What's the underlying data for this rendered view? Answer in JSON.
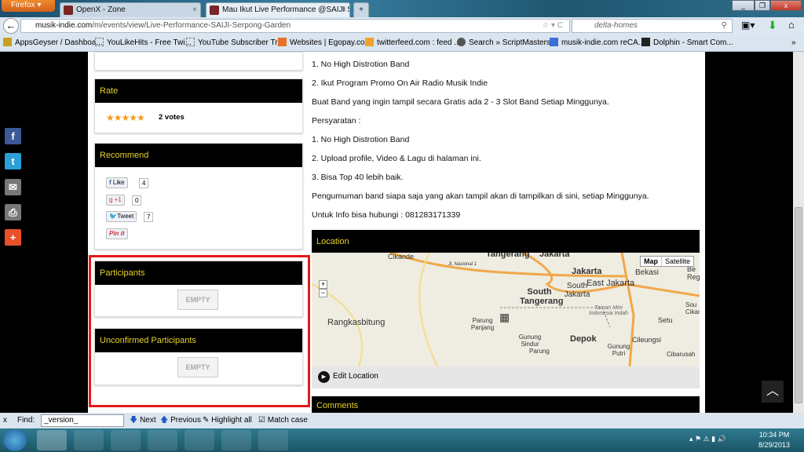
{
  "browser": {
    "menu_label": "Firefox",
    "tabs": [
      {
        "title": "OpenX - Zone"
      },
      {
        "title": "Mau Ikut Live Performance @SAIJI Se..."
      }
    ],
    "new_tab": "+",
    "url_domain": "musik-indie.com",
    "url_path": "/m/events/view/Live-Performance-SAIJI-Serpong-Garden",
    "search_value": "delta-homes",
    "bookmarks": [
      "AppsGeyser / Dashboa...",
      "YouLikeHits - Free Twi...",
      "YouTube Subscriber Tr...",
      "Websites | Egopay.com",
      "twitterfeed.com : feed ...",
      "Search » ScriptMasters...",
      "musik-indie.com reCA...",
      "Dolphin - Smart Com..."
    ],
    "bookmarks_overflow": "»"
  },
  "sidebar": {
    "rate": {
      "title": "Rate",
      "stars": 5,
      "votes": "2 votes"
    },
    "recommend": {
      "title": "Recommend",
      "facebook": {
        "label": "Like",
        "count": "4"
      },
      "gplus": {
        "label": "+1",
        "count": "0"
      },
      "twitter": {
        "label": "Tweet",
        "count": "7"
      },
      "pinterest": {
        "label": "Pin it"
      }
    },
    "participants": {
      "title": "Participants",
      "empty": "EMPTY"
    },
    "unconfirmed": {
      "title": "Unconfirmed Participants",
      "empty": "EMPTY"
    }
  },
  "main": {
    "lines": [
      "1. No High Distrotion Band",
      "2. Ikut Program Promo On Air Radio Musik Indie",
      "Buat Band yang ingin tampil secara Gratis ada 2 - 3 Slot Band Setiap Minggunya.",
      "Persyaratan :",
      "1. No High Distrotion Band",
      "2. Upload profile, Video & Lagu di halaman ini.",
      "3. Bisa Top 40 lebih baik.",
      "Pengumuman band siapa saja yang akan tampil akan di tampilkan di sini, setiap Minggunya.",
      "Untuk Info bisa hubungi : 081283171339"
    ],
    "location": {
      "title": "Location",
      "map_btn": "Map",
      "satellite_btn": "Satellite",
      "zoom_in": "+",
      "zoom_out": "−",
      "edit": "Edit Location",
      "labels": [
        "Cikande",
        "Tangerang",
        "Jakarta",
        "Jakarta",
        "East Jakarta",
        "Bekasi",
        "South Jakarta",
        "South Tangerang",
        "Rangkasbitung",
        "Parung Panjang",
        "Gunung Sindur",
        "Parung",
        "Depok",
        "Taman Mini Indonesia Indah",
        "Setu",
        "Cileungsi",
        "Gunung Putri",
        "Cibarusah",
        "Jl. Nasional 1",
        "Be Reg",
        "Sou Cikar"
      ]
    },
    "comments": {
      "title": "Comments"
    }
  },
  "findbar": {
    "close": "x",
    "label": "Find:",
    "value": "_version_",
    "next": "Next",
    "previous": "Previous",
    "highlight": "Highlight all",
    "match_case": "Match case"
  },
  "clock": {
    "time": "10:34 PM",
    "date": "8/29/2013"
  }
}
